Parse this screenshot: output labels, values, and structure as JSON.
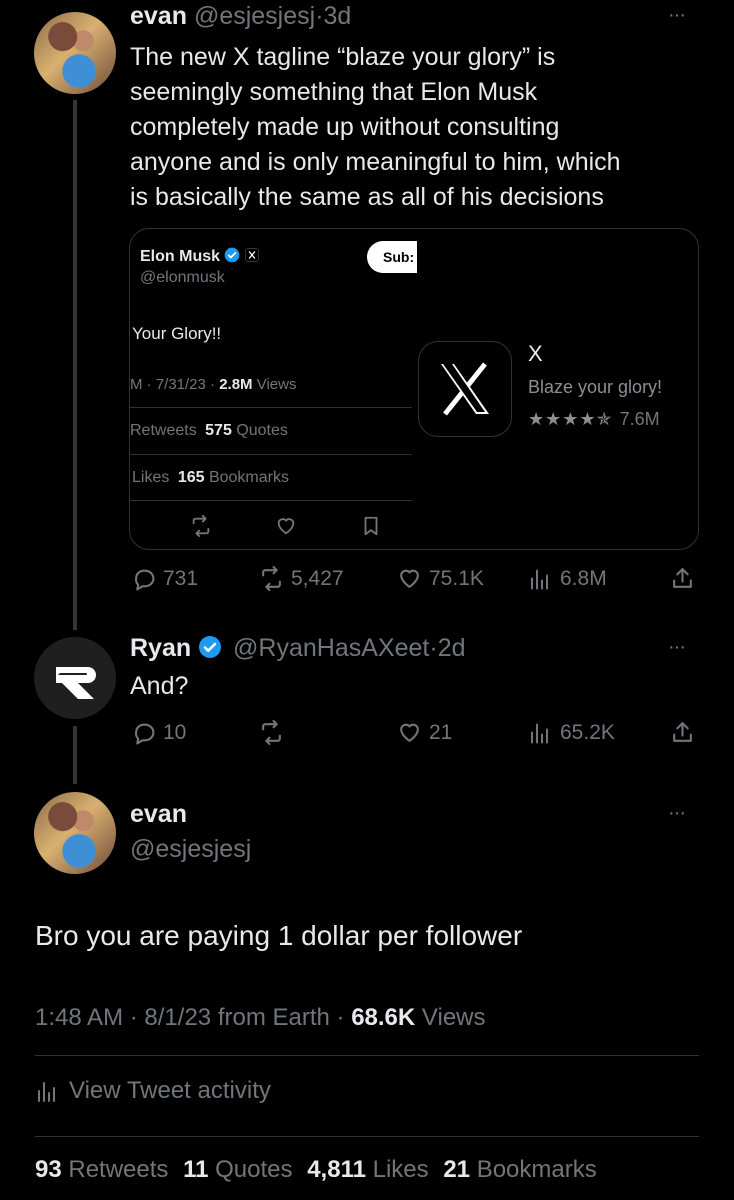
{
  "tweet1": {
    "name": "evan",
    "handle": "@esjesjesj",
    "sep": "·",
    "time": "3d",
    "text_lines": [
      "The new X tagline “blaze your glory” is",
      "seemingly something that Elon Musk",
      "completely made up without consulting",
      "anyone and is only meaningful to him, which",
      "is basically the same as all of his decisions"
    ],
    "embed": {
      "author": "Elon Musk",
      "handle": "@elonmusk",
      "subscribe": "Sub:",
      "text": "Your Glory!!",
      "meta_prefix": "M · 7/31/23 · ",
      "meta_views": "2.8M",
      "meta_suffix": " Views",
      "row1_a": "Retweets",
      "row1_b": "575",
      "row1_c": " Quotes",
      "row2_a": "Likes",
      "row2_b": "165",
      "row2_c": " Bookmarks",
      "app_name": "X",
      "app_tagline": "Blaze your glory!",
      "app_stars": "★★★★✯",
      "app_reviews": "7.6M"
    },
    "replies": "731",
    "retweets": "5,427",
    "likes": "75.1K",
    "views": "6.8M"
  },
  "tweet2": {
    "name": "Ryan",
    "handle": "@RyanHasAXeet",
    "sep": "·",
    "time": "2d",
    "text": "And?",
    "replies": "10",
    "likes": "21",
    "views": "65.2K"
  },
  "main": {
    "name": "evan",
    "handle": "@esjesjesj",
    "text": "Bro you are paying 1 dollar per follower",
    "time": "1:48 AM",
    "date": "8/1/23",
    "source": "from Earth",
    "views_count": "68.6K",
    "views_label": "Views",
    "activity": "View Tweet activity",
    "retweets": "93",
    "retweets_label": "Retweets",
    "quotes": "11",
    "quotes_label": "Quotes",
    "likes": "4,811",
    "likes_label": "Likes",
    "bookmarks": "21",
    "bookmarks_label": "Bookmarks"
  },
  "more_glyph": "···",
  "colors": {
    "background": "#000000",
    "text": "#e7e9ea",
    "muted": "#71767b",
    "verified": "#1d9bf0",
    "border": "#2f3336"
  }
}
